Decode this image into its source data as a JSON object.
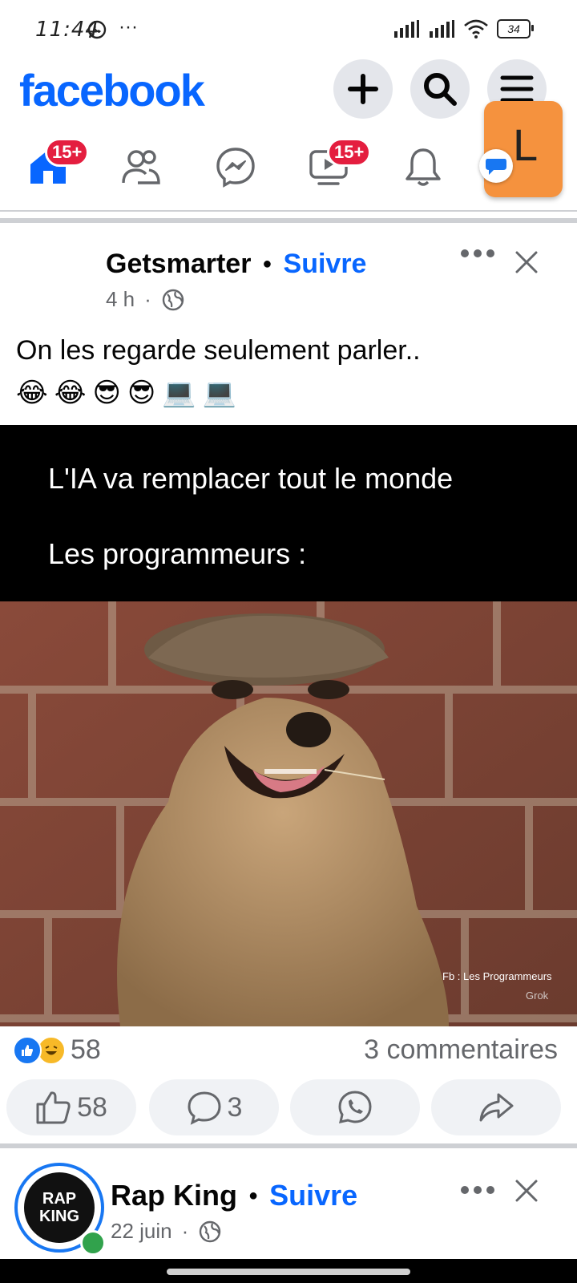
{
  "status": {
    "time": "11:44",
    "more": "···",
    "battery": "34"
  },
  "header": {
    "logo": "facebook",
    "avatar_letter": "L"
  },
  "nav": {
    "home_badge": "15+",
    "video_badge": "15+"
  },
  "post1": {
    "author": "Getsmarter",
    "follow": "Suivre",
    "time": "4 h",
    "caption": "On les regarde seulement parler..",
    "emojis": [
      "😂",
      "😂",
      "😎",
      "😎",
      "💻",
      "💻"
    ],
    "meme_line1": "L'IA va remplacer tout le monde",
    "meme_line2": "Les programmeurs :",
    "watermark": "Fb : Les Programmeurs",
    "watermark2": "Grok",
    "reaction_count": "58",
    "comments": "3 commentaires",
    "like_count": "58",
    "comment_count": "3"
  },
  "post2": {
    "author": "Rap King",
    "follow": "Suivre",
    "time": "22 juin",
    "avatar_text": "RAP KING"
  },
  "colors": {
    "brand": "#0866ff",
    "badge": "#e41e3f",
    "avatar": "#f5923e"
  }
}
